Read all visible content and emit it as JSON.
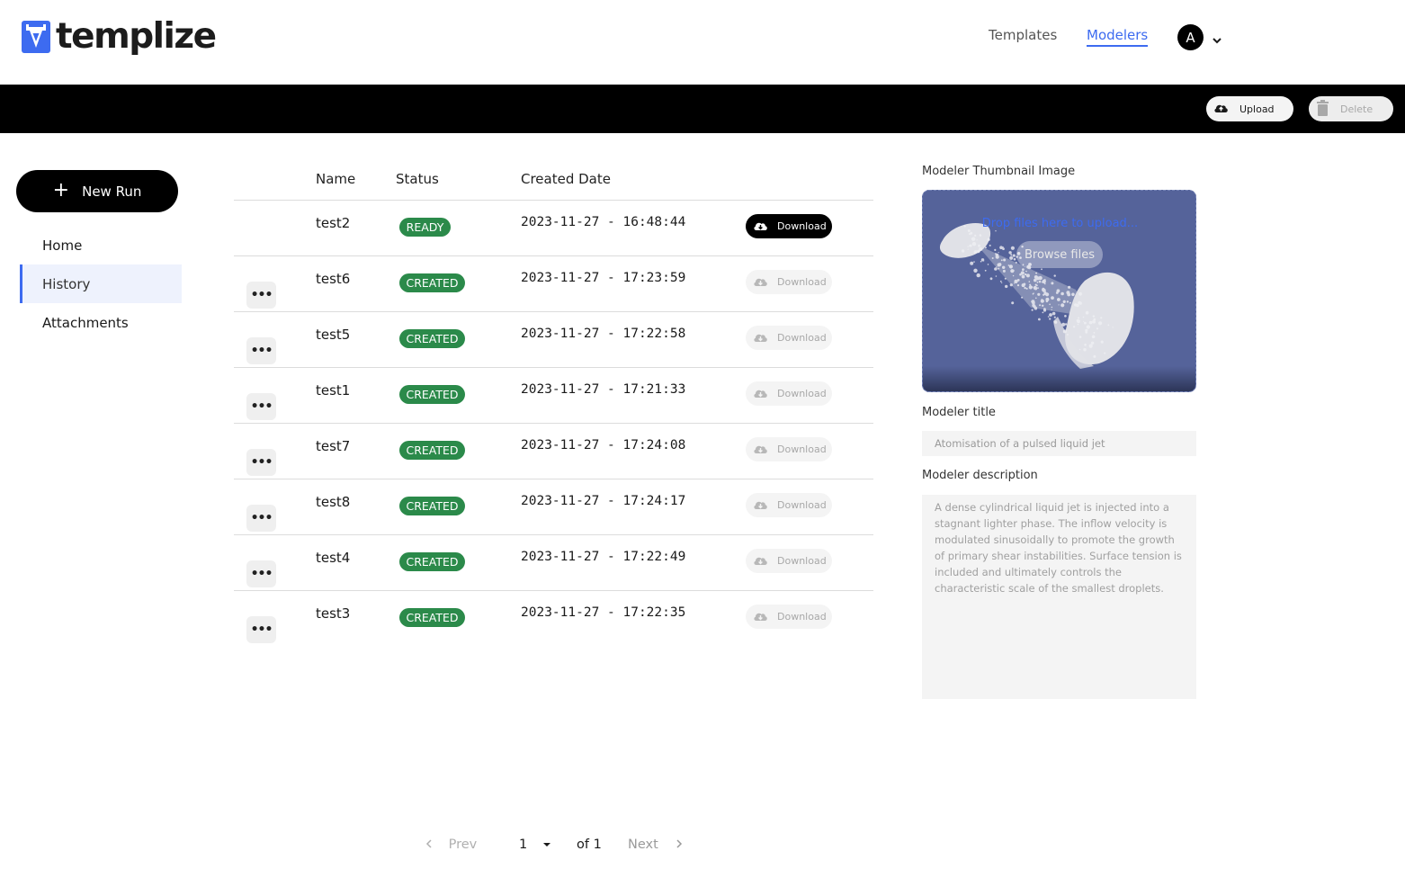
{
  "header": {
    "brand": "templize",
    "nav": [
      "Templates",
      "Modelers"
    ],
    "active_nav": "Modelers",
    "avatar_initial": "A"
  },
  "toolbar": {
    "upload_label": "Upload",
    "delete_label": "Delete"
  },
  "sidebar": {
    "new_run_label": "New Run",
    "items": [
      {
        "label": "Home",
        "active": false
      },
      {
        "label": "History",
        "active": true
      },
      {
        "label": "Attachments",
        "active": false
      }
    ]
  },
  "table": {
    "columns": [
      "Name",
      "Status",
      "Created Date"
    ],
    "rows": [
      {
        "name": "test2",
        "status": "READY",
        "created": "2023-11-27 - 16:48:44",
        "download": "Download",
        "download_enabled": true,
        "has_menu": false
      },
      {
        "name": "test6",
        "status": "CREATED",
        "created": "2023-11-27 - 17:23:59",
        "download": "Download",
        "download_enabled": false,
        "has_menu": true
      },
      {
        "name": "test5",
        "status": "CREATED",
        "created": "2023-11-27 - 17:22:58",
        "download": "Download",
        "download_enabled": false,
        "has_menu": true
      },
      {
        "name": "test1",
        "status": "CREATED",
        "created": "2023-11-27 - 17:21:33",
        "download": "Download",
        "download_enabled": false,
        "has_menu": true
      },
      {
        "name": "test7",
        "status": "CREATED",
        "created": "2023-11-27 - 17:24:08",
        "download": "Download",
        "download_enabled": false,
        "has_menu": true
      },
      {
        "name": "test8",
        "status": "CREATED",
        "created": "2023-11-27 - 17:24:17",
        "download": "Download",
        "download_enabled": false,
        "has_menu": true
      },
      {
        "name": "test4",
        "status": "CREATED",
        "created": "2023-11-27 - 17:22:49",
        "download": "Download",
        "download_enabled": false,
        "has_menu": true
      },
      {
        "name": "test3",
        "status": "CREATED",
        "created": "2023-11-27 - 17:22:35",
        "download": "Download",
        "download_enabled": false,
        "has_menu": true
      }
    ],
    "menu_glyph": "•••"
  },
  "pagination": {
    "prev": "Prev",
    "page": "1",
    "of": "of 1",
    "next": "Next"
  },
  "details": {
    "thumbnail_label": "Modeler Thumbnail Image",
    "drop_text": "Drop files here to upload...",
    "browse_label": "Browse files",
    "title_label": "Modeler title",
    "title_value": "Atomisation of a pulsed liquid jet",
    "description_label": "Modeler description",
    "description_value": "A dense cylindrical liquid jet is injected into a stagnant lighter phase. The inflow velocity is modulated sinusoidally to promote the growth of primary shear instabilities. Surface tension is included and ultimately controls the characteristic scale of the smallest droplets."
  },
  "colors": {
    "accent": "#3d6bf0",
    "status_green": "#2b8a4a",
    "black": "#000000"
  },
  "icons": {
    "upload": "cloud-upload-icon",
    "delete": "trash-icon",
    "download": "cloud-download-icon",
    "new_run": "plus-icon",
    "avatar_menu": "chevron-down-icon",
    "prev": "chevron-left-icon",
    "next": "chevron-right-icon",
    "row_menu": "more-icon"
  }
}
